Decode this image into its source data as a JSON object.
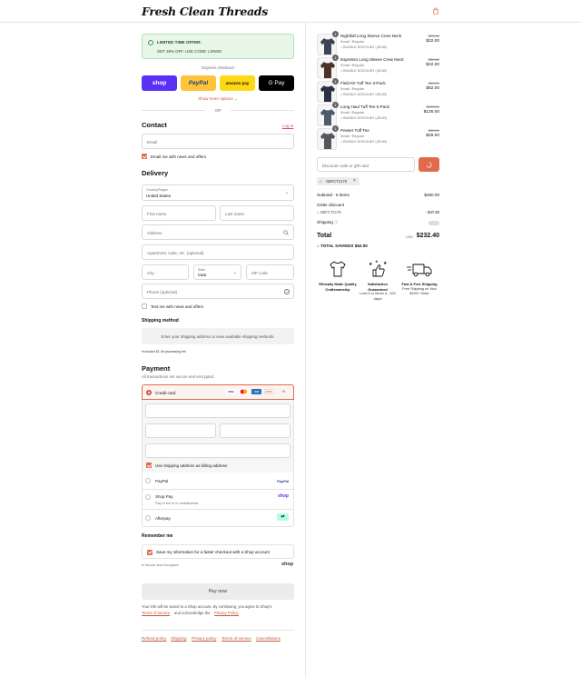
{
  "store": {
    "name": "Fresh Clean Threads"
  },
  "offer": {
    "title": "LIMITED TIME OFFER:",
    "text": "GET 30% OFF. USE CODE: LDW30"
  },
  "express": {
    "label": "Express checkout",
    "buttons": [
      {
        "name": "shop-pay-button",
        "label": "shop",
        "bg": "#5a31f4",
        "fg": "#ffffff"
      },
      {
        "name": "paypal-button",
        "label": "PayPal",
        "bg": "#ffc439",
        "fg": "#253b80"
      },
      {
        "name": "amazon-pay-button",
        "label": "amazon pay",
        "bg": "#ffd814",
        "fg": "#111111"
      },
      {
        "name": "google-pay-button",
        "label": "G Pay",
        "bg": "#000000",
        "fg": "#ffffff"
      }
    ],
    "more": "Show more options",
    "or": "OR"
  },
  "contact": {
    "title": "Contact",
    "login": "Log in",
    "email_placeholder": "Email",
    "news": "Email me with news and offers"
  },
  "delivery": {
    "title": "Delivery",
    "country_label": "Country/Region",
    "country_value": "United States",
    "first": "First name",
    "last": "Last name",
    "address": "Address",
    "apt": "Apartment, suite, etc. (optional)",
    "city": "City",
    "state_label": "State",
    "state_value": "Iowa",
    "zip": "ZIP code",
    "phone": "Phone (optional)",
    "text_news": "Text me with news and offers"
  },
  "shipping_method": {
    "title": "Shipping method",
    "message": "Enter your shipping address to view available shipping methods.",
    "note": "*Includes $1.49 processing fee"
  },
  "payment": {
    "title": "Payment",
    "subtitle": "All transactions are secure and encrypted.",
    "credit_card": "Credit card",
    "card_more": "+5",
    "billing": "Use shipping address as billing address",
    "paypal": "PayPal",
    "shop_pay": "Shop Pay",
    "shop_pay_sub": "Pay in full or in installments",
    "afterpay": "Afterpay"
  },
  "remember": {
    "title": "Remember me",
    "save": "Save my information for a faster checkout with a Shop account",
    "secure": "Secure and encrypted",
    "shop": "shop"
  },
  "pay_now": "Pay now",
  "legal": {
    "text1": "Your info will be saved to a Shop account. By continuing, you agree to Shop's",
    "tos": "Terms of Service",
    "and": "and acknowledge the",
    "privacy": "Privacy Policy."
  },
  "footer": [
    "Refund policy",
    "Shipping",
    "Privacy policy",
    "Terms of service",
    "Cancellations"
  ],
  "cart": {
    "items": [
      {
        "qty": "1",
        "name": "Nightfall Long Sleeve Crew Neck",
        "variant": "Small / Regular",
        "discount": "BUNDLE DISCOUNT (-$3.80)",
        "orig": "$25.80",
        "price": "$22.00",
        "color": "#3b4452"
      },
      {
        "qty": "1",
        "name": "Espresso Long Sleeve Crew Neck",
        "variant": "Small / Regular",
        "discount": "BUNDLE DISCOUNT (-$3.80)",
        "orig": "$25.80",
        "price": "$22.00",
        "color": "#4b3427"
      },
      {
        "qty": "1",
        "name": "Field Kit Tuff Tee 3-Pack",
        "variant": "Small / Regular",
        "discount": "BUNDLE DISCOUNT (-$3.80)",
        "orig": "$85.80",
        "price": "$82.00",
        "color": "#2a3345"
      },
      {
        "qty": "1",
        "name": "Long Haul Tuff Tee 5-Pack",
        "variant": "Small / Regular",
        "discount": "BUNDLE DISCOUNT (-$3.80)",
        "orig": "$128.80",
        "price": "$125.00",
        "color": "#4e5a6a"
      },
      {
        "qty": "1",
        "name": "Pewter Tuff Tee",
        "variant": "Small / Regular",
        "discount": "BUNDLE DISCOUNT (-$3.80)",
        "orig": "$32.80",
        "price": "$29.00",
        "color": "#54585e"
      }
    ],
    "discount_placeholder": "Discount code or gift card",
    "applied_code": "SBFCT2175",
    "subtotal_label": "Subtotal · 5 items",
    "subtotal": "$280.00",
    "order_discount_label": "Order discount",
    "order_discount_code": "SBFCT2175",
    "order_discount": "- $47.60",
    "shipping_label": "Shipping",
    "total_label": "Total",
    "currency": "USD",
    "total": "$232.40",
    "savings_label": "TOTAL SAVINGS",
    "savings": "$62.00"
  },
  "features": [
    {
      "title": "Ethically Made Quality Craftsmanship",
      "desc": ""
    },
    {
      "title": "Satisfaction Guaranteed",
      "desc": "Love it or return it - 100 days!"
    },
    {
      "title": "Fast & Free Shipping",
      "desc": "Free Shipping on Your $100+ Order"
    }
  ],
  "colors": {
    "accent": "#e06a4c",
    "link": "#c45a3d",
    "shop": "#5a31f4"
  }
}
